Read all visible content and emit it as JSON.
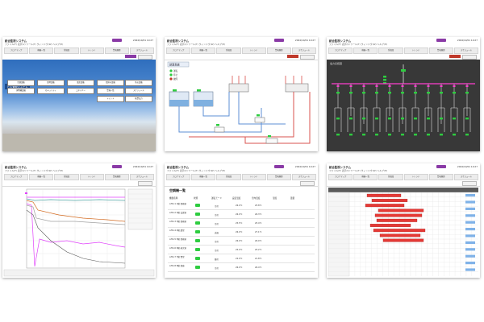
{
  "app": {
    "title": "統合監視システム",
    "menu": "ファイル(F)  表示(V)  ツール(T)  ウィンドウ(W)  ヘルプ(H)",
    "clock": "2024/10/01 10:27"
  },
  "tabs": [
    "フロアマップ",
    "機器一覧",
    "系統図",
    "トレンド",
    "警報履歴",
    "スケジュール",
    "設定"
  ],
  "panel1": {
    "system_name": "ビル管理システム",
    "buttons": [
      "空調設備",
      "照明設備",
      "電気設備",
      "給排水設備",
      "防災設備",
      "昇降機設備",
      "セキュリティ",
      "エネルギー",
      "警報一覧",
      "スケジュール",
      "トレンド",
      "帳票出力"
    ]
  },
  "panel2": {
    "header": "熱源系統",
    "legend": [
      "運転",
      "停止",
      "故障"
    ]
  },
  "panel3": {
    "header": "電力系統図"
  },
  "panel5": {
    "heading": "空調機一覧",
    "columns": [
      "機器名称",
      "状態",
      "運転モード",
      "設定温度",
      "室内温度",
      "湿度",
      "風量"
    ],
    "rows": [
      {
        "name": "AHU-1 1階 事務室",
        "v1": "冷房",
        "v2": "26.0℃",
        "v3": "25.8℃"
      },
      {
        "name": "AHU-2 2階 会議室",
        "v1": "冷房",
        "v2": "26.0℃",
        "v3": "26.3℃"
      },
      {
        "name": "AHU-3 3階 事務室",
        "v1": "冷房",
        "v2": "25.5℃",
        "v3": "25.4℃"
      },
      {
        "name": "AHU-4 4階 講堂",
        "v1": "送風",
        "v2": "26.0℃",
        "v3": "27.1℃"
      },
      {
        "name": "AHU-5 5階 事務室",
        "v1": "冷房",
        "v2": "26.0℃",
        "v3": "26.0℃"
      },
      {
        "name": "AHU-6 6階 研究室",
        "v1": "冷房",
        "v2": "25.0℃",
        "v3": "25.2℃"
      },
      {
        "name": "AHU-7 7階 食堂",
        "v1": "暖房",
        "v2": "22.0℃",
        "v3": "21.8℃"
      },
      {
        "name": "AHU-8 8階 倉庫",
        "v1": "冷房",
        "v2": "26.0℃",
        "v3": "26.4℃"
      }
    ]
  },
  "colors": {
    "accent": "#8a3aa6",
    "alarm": "#c0392b",
    "run": "#2ecc40",
    "gantt": "#e53935",
    "dark_bg": "#383838"
  }
}
